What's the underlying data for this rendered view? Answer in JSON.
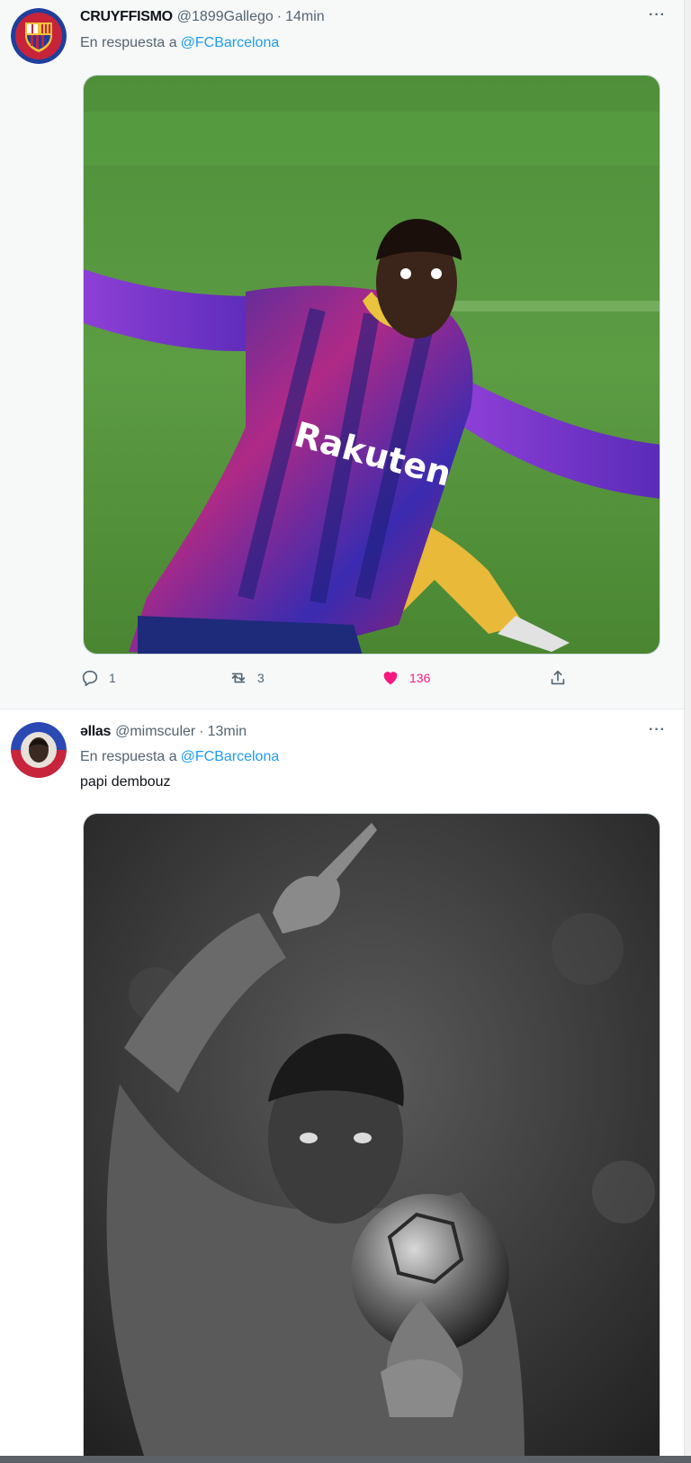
{
  "tweets": [
    {
      "author": {
        "display_name": "CRUYFFISMO",
        "handle": "@1899Gallego",
        "avatar": "fc-barcelona-crest-avatar"
      },
      "separator": "·",
      "time": "14min",
      "reply_to_prefix": "En respuesta a",
      "reply_to_handle": "@FCBarcelona",
      "media": {
        "icon": "photo-player-celebrating-purple-kit"
      },
      "actions": {
        "replies": "1",
        "retweets": "3",
        "likes": "136",
        "liked": true
      },
      "more_label": "···"
    },
    {
      "author": {
        "display_name": "ǝllas",
        "handle": "@mimsculer",
        "avatar": "player-portrait-avatar"
      },
      "separator": "·",
      "time": "13min",
      "reply_to_prefix": "En respuesta a",
      "reply_to_handle": "@FCBarcelona",
      "text": "papi dembouz",
      "media": {
        "icon": "photo-player-with-ballon-dor-bw"
      },
      "more_label": "···"
    }
  ],
  "colors": {
    "accent": "#1d9bf0",
    "like": "#f91880",
    "secondary_text": "#536471"
  }
}
